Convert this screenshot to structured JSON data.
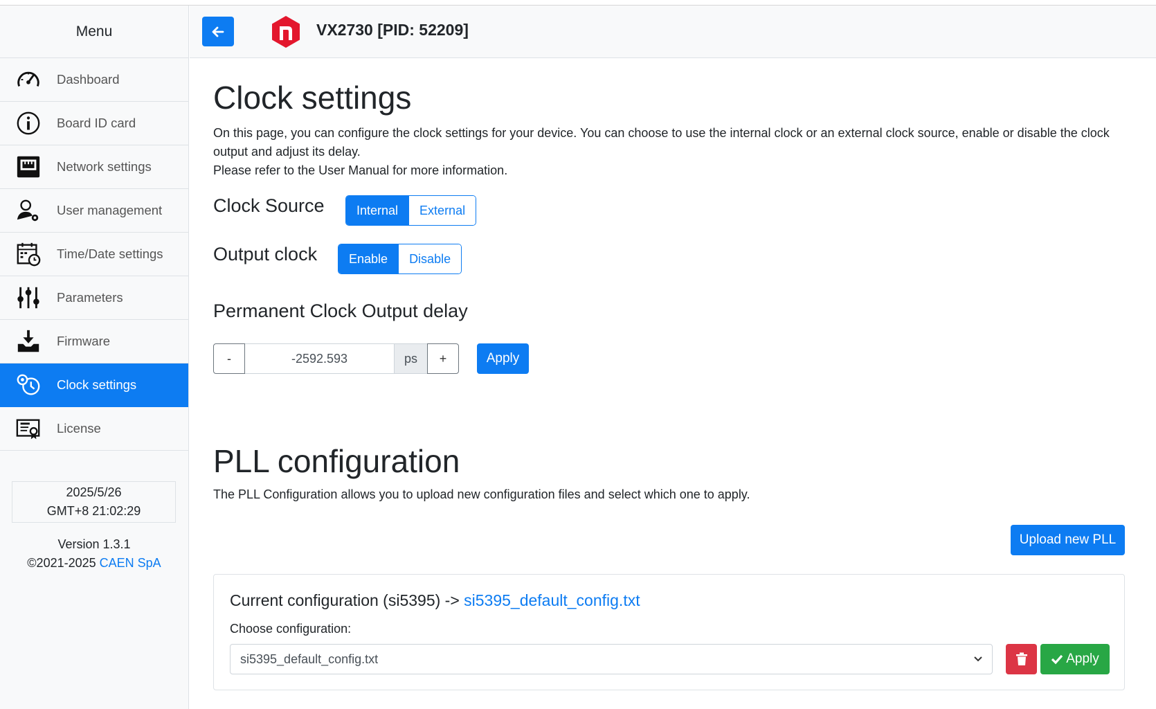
{
  "sidebar": {
    "title": "Menu",
    "items": [
      {
        "label": "Dashboard",
        "icon": "gauge-icon"
      },
      {
        "label": "Board ID card",
        "icon": "info-icon"
      },
      {
        "label": "Network settings",
        "icon": "ethernet-icon"
      },
      {
        "label": "User management",
        "icon": "user-gear-icon"
      },
      {
        "label": "Time/Date settings",
        "icon": "calendar-clock-icon"
      },
      {
        "label": "Parameters",
        "icon": "sliders-icon"
      },
      {
        "label": "Firmware",
        "icon": "download-tray-icon"
      },
      {
        "label": "Clock settings",
        "icon": "clock-gear-icon",
        "active": true
      },
      {
        "label": "License",
        "icon": "license-icon"
      }
    ],
    "date": "2025/5/26",
    "time": "GMT+8 21:02:29",
    "version": "Version 1.3.1",
    "copyright": "©2021-2025 ",
    "company": "CAEN SpA"
  },
  "header": {
    "device_title": "VX2730 [PID: 52209]"
  },
  "clock": {
    "title": "Clock settings",
    "desc_line1": "On this page, you can configure the clock settings for your device. You can choose to use the internal clock or an external clock source, enable or disable the clock output and adjust its delay.",
    "desc_line2": "Please refer to the User Manual for more information.",
    "source_label": "Clock Source",
    "source_options": [
      "Internal",
      "External"
    ],
    "source_selected": "Internal",
    "output_label": "Output clock",
    "output_options": [
      "Enable",
      "Disable"
    ],
    "output_selected": "Enable",
    "delay_title": "Permanent Clock Output delay",
    "minus": "-",
    "delay_value": "-2592.593",
    "unit": "ps",
    "plus": "+",
    "apply": "Apply"
  },
  "pll": {
    "title": "PLL configuration",
    "desc": "The PLL Configuration allows you to upload new configuration files and select which one to apply.",
    "upload": "Upload new PLL",
    "current_prefix": "Current configuration (si5395) -> ",
    "current_file": "si5395_default_config.txt",
    "choose_label": "Choose configuration:",
    "selected": "si5395_default_config.txt",
    "apply": "Apply"
  },
  "colors": {
    "primary": "#0d7cf2",
    "danger": "#dc3545",
    "success": "#28a745",
    "logo": "#e3172d"
  }
}
